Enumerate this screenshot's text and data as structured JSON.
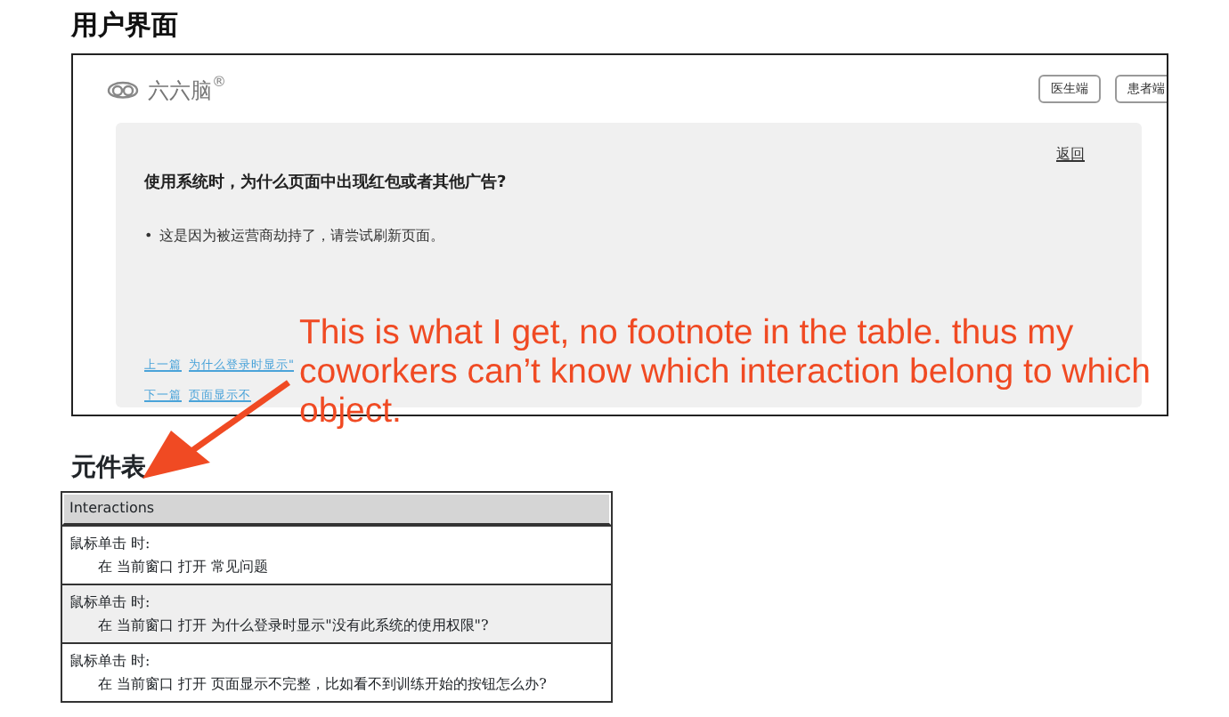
{
  "section_title": "用户界面",
  "app": {
    "logo": "六六脑",
    "logo_mark": "®",
    "buttons": [
      "医生端",
      "患者端"
    ],
    "back": "返回",
    "question": "使用系统时，为什么页面中出现红包或者其他广告?",
    "bullet": "•",
    "answer": "这是因为被运营商劫持了，请尝试刷新页面。",
    "nav": [
      {
        "label": "上一篇",
        "title": "为什么登录时显示\""
      },
      {
        "label": "下一篇",
        "title": "页面显示不"
      }
    ]
  },
  "annotation": {
    "lines": [
      "This is what I get, no footnote in the table. thus my",
      "coworkers can’t know which  interaction belong to which",
      "object."
    ]
  },
  "table_title": "元件表",
  "table": {
    "header": "Interactions",
    "rows": [
      {
        "event": "鼠标单击 时:",
        "action": "在 当前窗口 打开 常见问题",
        "shaded": false
      },
      {
        "event": "鼠标单击 时:",
        "action": "在 当前窗口 打开 为什么登录时显示\"没有此系统的使用权限\"?",
        "shaded": true
      },
      {
        "event": "鼠标单击 时:",
        "action": "在 当前窗口 打开 页面显示不完整，比如看不到训练开始的按钮怎么办?",
        "shaded": false
      }
    ]
  }
}
